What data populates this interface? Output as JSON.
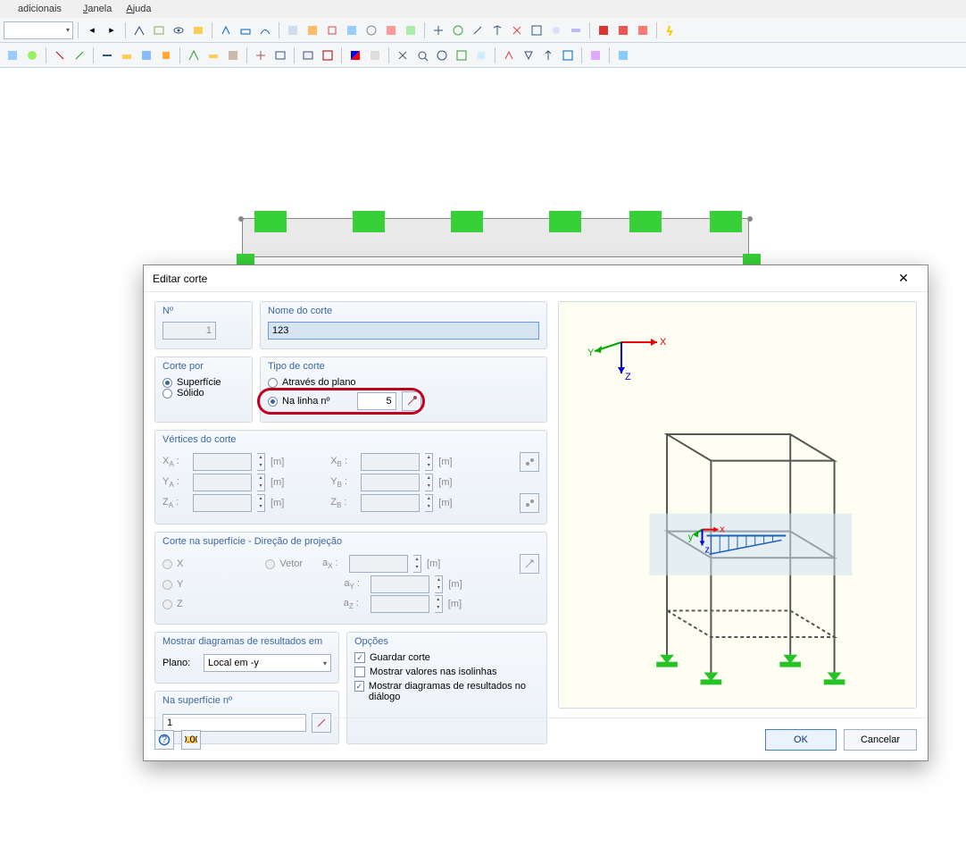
{
  "menu": {
    "additional": "adicionais",
    "window": "Janela",
    "help": "Ajuda"
  },
  "dialog": {
    "title": "Editar corte",
    "no_legend": "Nº",
    "no_value": "1",
    "name_legend": "Nome do corte",
    "name_value": "123",
    "cut_by_legend": "Corte por",
    "cut_by_surface": "Superfície",
    "cut_by_solid": "Sólido",
    "cut_type_legend": "Tipo de corte",
    "cut_type_plane": "Através do plano",
    "cut_type_line": "Na linha nº",
    "line_value": "5",
    "vertices_legend": "Vértices do corte",
    "labels": {
      "xa": "XA :",
      "ya": "YA :",
      "za": "ZA :",
      "xb": "XB :",
      "yb": "YB :",
      "zb": "ZB :",
      "ax": "aX :",
      "ay": "aY :",
      "az": "aZ :"
    },
    "unit_m": "[m]",
    "proj_legend": "Corte na superfície - Direção de projeção",
    "proj_x": "X",
    "proj_y": "Y",
    "proj_z": "Z",
    "proj_vector": "Vetor",
    "show_legend": "Mostrar diagramas de resultados em",
    "plane_label": "Plano:",
    "plane_value": "Local em -y",
    "insurf_legend": "Na superfície nº",
    "insurf_value": "1",
    "opts_legend": "Opções",
    "opt_save": "Guardar corte",
    "opt_iso": "Mostrar valores nas isolinhas",
    "opt_diag": "Mostrar diagramas de resultados no diálogo",
    "ok": "OK",
    "cancel": "Cancelar"
  },
  "axis": {
    "x": "X",
    "y": "Y",
    "z": "Z"
  }
}
